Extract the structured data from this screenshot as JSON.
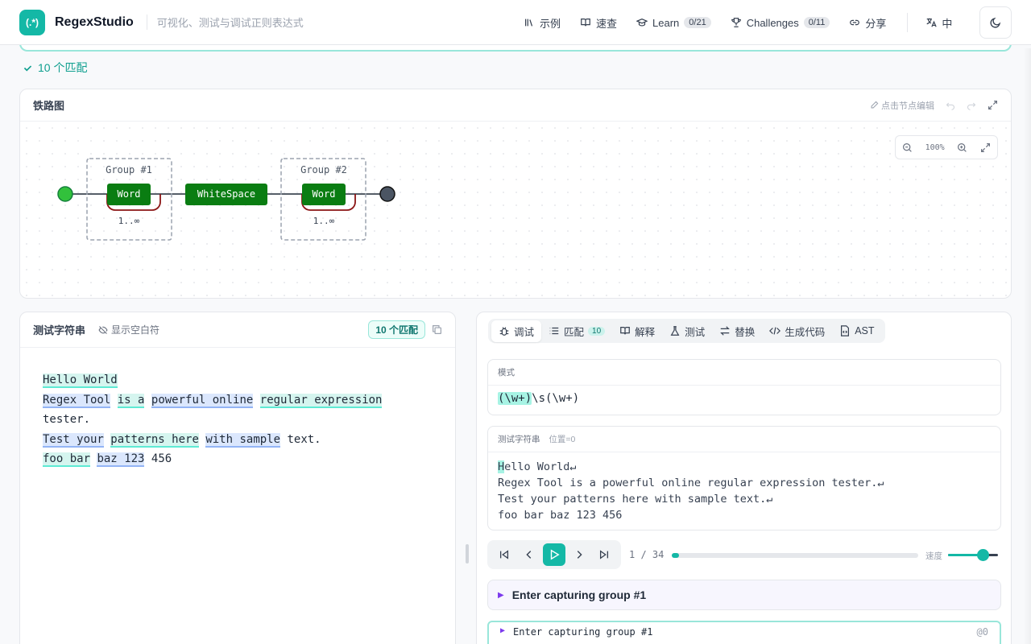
{
  "app": {
    "logo_glyph": "(.*)",
    "name": "RegexStudio",
    "tagline": "可视化、测试与调试正则表达式"
  },
  "nav": {
    "examples": "示例",
    "cheatsheet": "速查",
    "learn": "Learn",
    "learn_progress": "0/21",
    "challenges": "Challenges",
    "challenges_progress": "0/11",
    "share": "分享",
    "language": "中"
  },
  "status": {
    "match_text": "10 个匹配"
  },
  "railroad": {
    "title": "铁路图",
    "edit_hint": "点击节点编辑",
    "zoom": "100%",
    "group1_label": "Group #1",
    "group2_label": "Group #2",
    "node_word": "Word",
    "node_whitespace": "WhiteSpace",
    "repeat_label": "1..∞"
  },
  "test_string": {
    "title": "测试字符串",
    "whitespace_toggle": "显示空白符",
    "match_count": "10 个匹配"
  },
  "debugger": {
    "tabs": {
      "debug": "调试",
      "matches": "匹配",
      "matches_count": "10",
      "explain": "解释",
      "test": "测试",
      "replace": "替换",
      "codegen": "生成代码",
      "ast": "AST"
    },
    "pattern_label": "模式",
    "pattern_group": "(\\w+)",
    "pattern_rest": "\\s(\\w+)",
    "teststring_label": "测试字符串",
    "position_label": "位置=0",
    "debug_first_char": "H",
    "debug_text_rest": "ello World↵\nRegex Tool is a powerful online regular expression tester.↵\nTest your patterns here with sample text.↵\nfoo bar baz 123 456",
    "step_counter": "1 / 34",
    "progress": 0.03,
    "speed_label": "速度",
    "speed": 0.7,
    "current_step": "Enter capturing group #1",
    "log_entry": "Enter capturing group #1",
    "log_position": "@0"
  },
  "colors": {
    "accent": "#14b8a6",
    "node_green": "#0a7d12",
    "match_teal": "#d5f5ef",
    "match_blue": "#dbe7fd"
  }
}
